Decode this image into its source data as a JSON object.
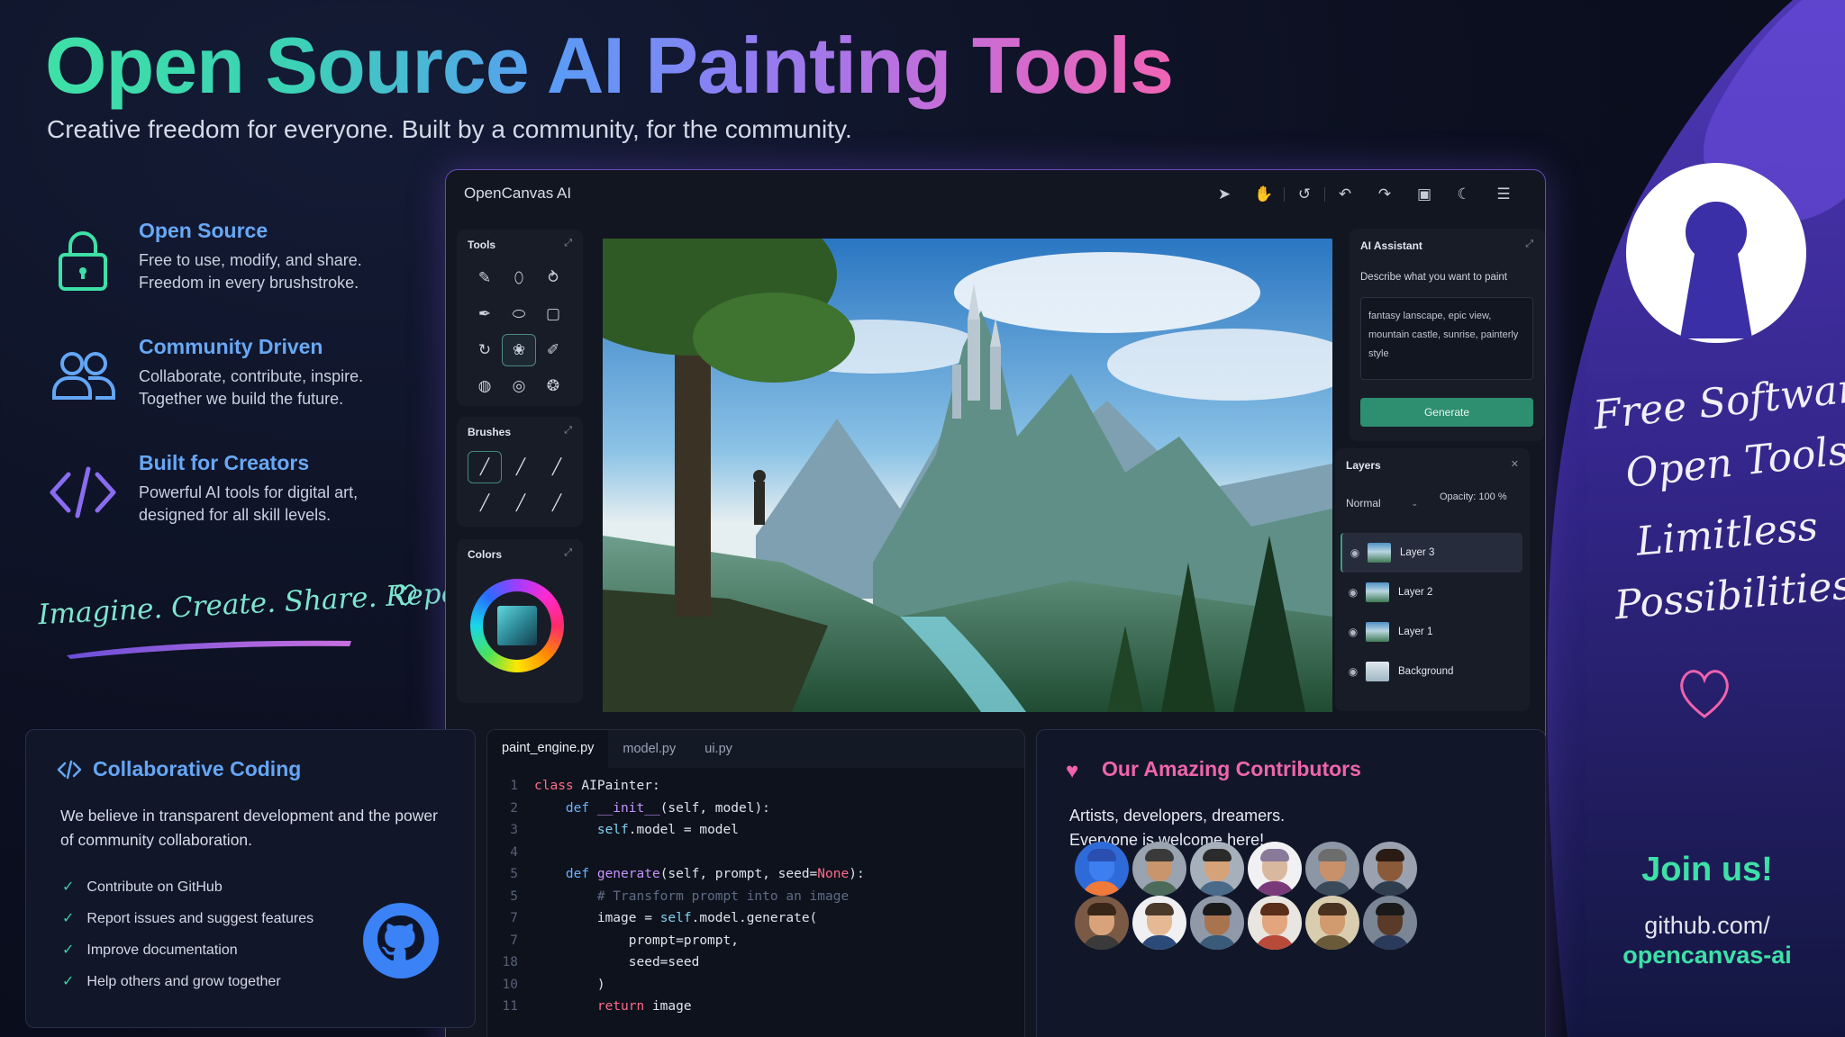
{
  "header": {
    "title": "Open Source AI Painting Tools",
    "subtitle": "Creative freedom for everyone. Built by a community, for the community."
  },
  "features": [
    {
      "title": "Open Source",
      "line1": "Free to use, modify, and share.",
      "line2": "Freedom in every brushstroke.",
      "icon": "lock-icon"
    },
    {
      "title": "Community Driven",
      "line1": "Collaborate, contribute, inspire.",
      "line2": "Together we build the future.",
      "icon": "users-icon"
    },
    {
      "title": "Built for Creators",
      "line1": "Powerful AI tools for digital art,",
      "line2": "designed for all skill levels.",
      "icon": "code-icon"
    }
  ],
  "tagline": "Imagine. Create. Share. Repeat.",
  "app": {
    "title": "OpenCanvas AI",
    "toolbar": [
      "cursor-icon",
      "hand-icon",
      "rotate-icon",
      "undo-icon",
      "redo-icon",
      "save-icon",
      "moon-icon",
      "menu-icon"
    ],
    "tools": {
      "label": "Tools"
    },
    "brushes": {
      "label": "Brushes"
    },
    "colors": {
      "label": "Colors",
      "selected": "#2e8b99"
    },
    "ai_assistant": {
      "label": "AI Assistant",
      "prompt_label": "Describe what you want to paint",
      "prompt_value": "fantasy lanscape, epic view, mountain castle, sunrise, painterly style",
      "generate_label": "Generate"
    },
    "layers": {
      "label": "Layers",
      "blend_mode": "Normal",
      "opacity": "Opacity: 100 %",
      "items": [
        "Layer 3",
        "Layer 2",
        "Layer 1",
        "Background"
      ],
      "selected": "Layer 3"
    }
  },
  "collab": {
    "title": "Collaborative Coding",
    "text": "We believe in transparent development and the power of community collaboration.",
    "items": [
      "Contribute on GitHub",
      "Report issues and suggest features",
      "Improve documentation",
      "Help others and grow together"
    ]
  },
  "editor": {
    "tabs": [
      "paint_engine.py",
      "model.py",
      "ui.py"
    ],
    "active_tab": "paint_engine.py",
    "line_numbers": [
      "1",
      "2",
      "3",
      "4",
      "5",
      "5",
      "7",
      "7",
      "18",
      "10",
      "11"
    ]
  },
  "contributors": {
    "title": "Our Amazing Contributors",
    "line1": "Artists, developers, dreamers.",
    "line2": "Everyone is welcome here!",
    "count": 12
  },
  "banner": {
    "line1": "Free Software",
    "line2": "Open Tools",
    "line3": "Limitless",
    "line4": "Possibilities",
    "join": "Join us!",
    "url1": "github.com/",
    "url2": "opencanvas-ai"
  },
  "colors": {
    "accent_green": "#3ee0a6",
    "accent_blue": "#64a6f5",
    "accent_pink": "#ef64ad",
    "generate_button": "#2e8f70"
  }
}
